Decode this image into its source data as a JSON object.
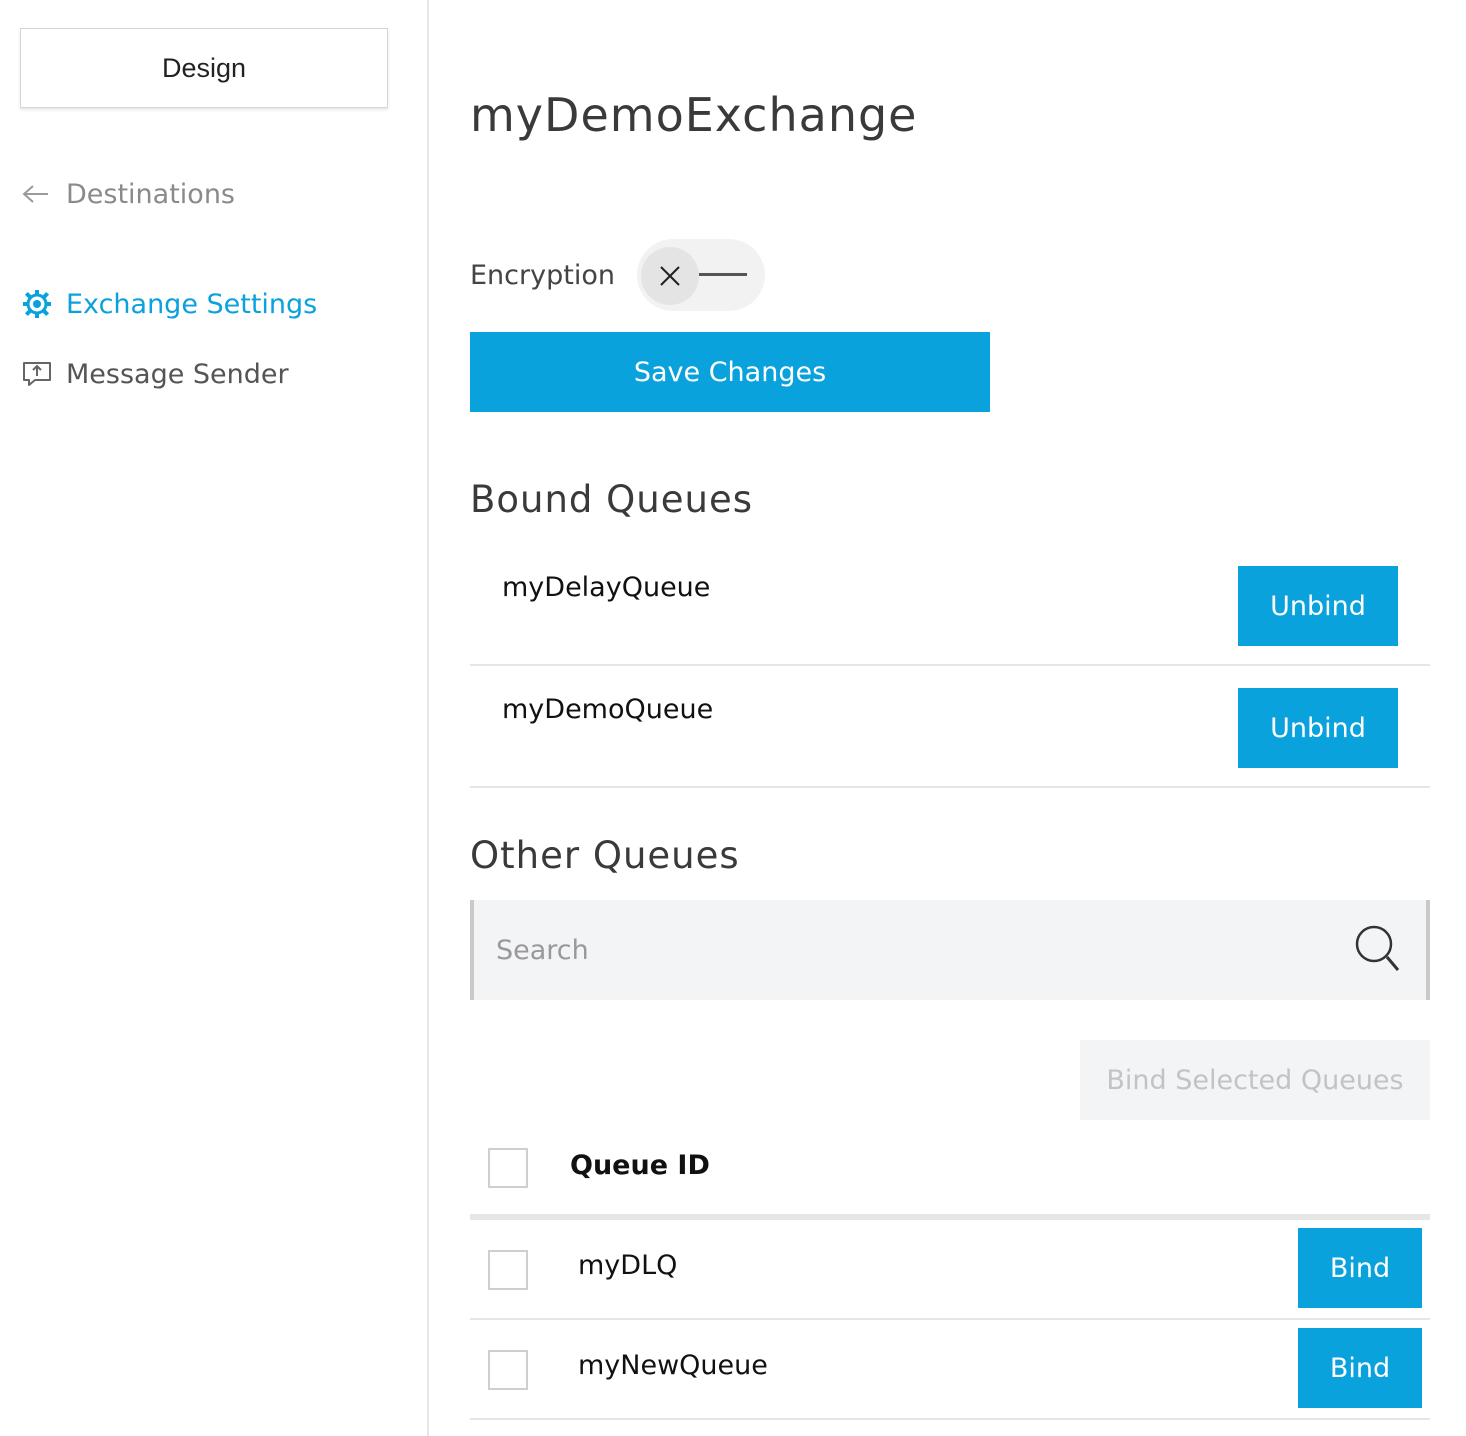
{
  "sidebar": {
    "design_label": "Design",
    "back_label": "Destinations",
    "items": [
      {
        "label": "Exchange Settings",
        "icon": "gear-icon",
        "active": true
      },
      {
        "label": "Message Sender",
        "icon": "message-sender-icon",
        "active": false
      }
    ]
  },
  "main": {
    "title": "myDemoExchange",
    "encryption": {
      "label": "Encryption",
      "enabled": false
    },
    "save_label": "Save Changes",
    "bound_queues": {
      "title": "Bound Queues",
      "items": [
        {
          "name": "myDelayQueue",
          "action": "Unbind"
        },
        {
          "name": "myDemoQueue",
          "action": "Unbind"
        }
      ]
    },
    "other_queues": {
      "title": "Other Queues",
      "search_placeholder": "Search",
      "bind_selected_label": "Bind Selected Queues",
      "column_header": "Queue ID",
      "rows": [
        {
          "name": "myDLQ",
          "action": "Bind"
        },
        {
          "name": "myNewQueue",
          "action": "Bind"
        }
      ]
    }
  },
  "colors": {
    "accent": "#0aa2dc",
    "disabled_bg": "#f3f4f6",
    "disabled_text": "#c3c3c3",
    "divider": "#e6e6e6"
  }
}
